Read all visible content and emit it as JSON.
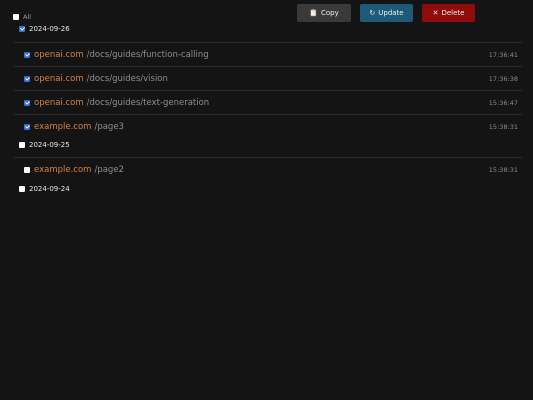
{
  "toolbar": {
    "copy_label": "Copy",
    "copy_icon": "clipboard-icon",
    "update_label": "Update",
    "update_icon": "refresh-icon",
    "delete_label": "Delete",
    "delete_icon": "close-icon",
    "colors": {
      "copy": "#3a3a3a",
      "update": "#1d5a77",
      "delete": "#8f0c0c"
    }
  },
  "select_all": {
    "label": "All",
    "checked": false
  },
  "groups": [
    {
      "date": "2024-09-26",
      "checked": true,
      "entries": [
        {
          "domain": "openai.com",
          "path": "/docs/guides/function-calling",
          "time": "17:36:41",
          "checked": true
        },
        {
          "domain": "openai.com",
          "path": "/docs/guides/vision",
          "time": "17:36:38",
          "checked": true
        },
        {
          "domain": "openai.com",
          "path": "/docs/guides/text-generation",
          "time": "15:36:47",
          "checked": true
        },
        {
          "domain": "example.com",
          "path": "/page3",
          "time": "15:38:31",
          "checked": true
        }
      ]
    },
    {
      "date": "2024-09-25",
      "checked": false,
      "entries": [
        {
          "domain": "example.com",
          "path": "/page2",
          "time": "15:38:31",
          "checked": false
        }
      ]
    },
    {
      "date": "2024-09-24",
      "checked": false,
      "entries": []
    }
  ],
  "colors": {
    "background": "#141414",
    "domain": "#d9823c",
    "checkbox_checked": "#2f6fd6"
  }
}
